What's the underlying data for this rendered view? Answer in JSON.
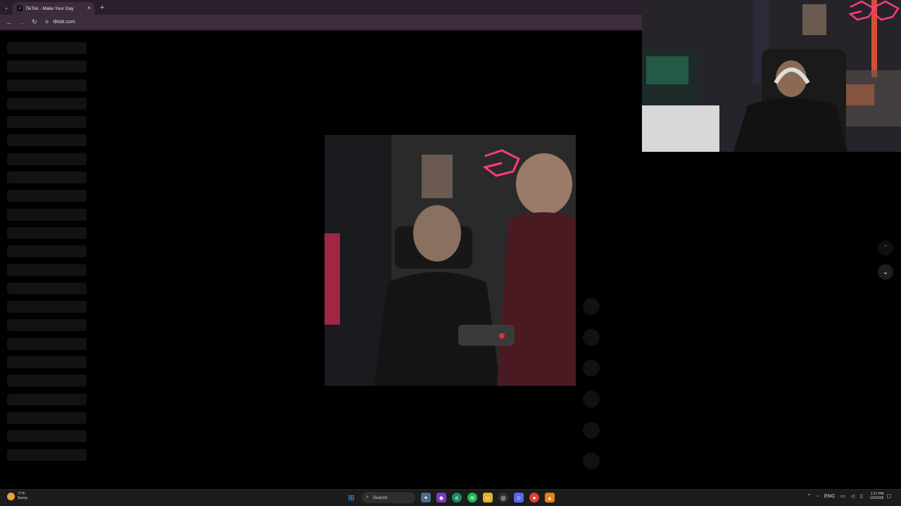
{
  "browser": {
    "tab_title": "TikTok - Make Your Day",
    "tab_favicon": "tiktok-icon",
    "url": "tiktok.com"
  },
  "taskbar": {
    "weather_temp": "77°F",
    "weather_desc": "Sunny",
    "search_label": "Search",
    "lang": "ENG",
    "time": "1:27 PM",
    "date": "1/6/2026"
  },
  "colors": {
    "chrome_tab_bar": "#2b1e2b",
    "chrome_toolbar": "#3c2c3c",
    "neon_pink": "#ff3b7a",
    "taskbar": "#1c1c1c"
  }
}
